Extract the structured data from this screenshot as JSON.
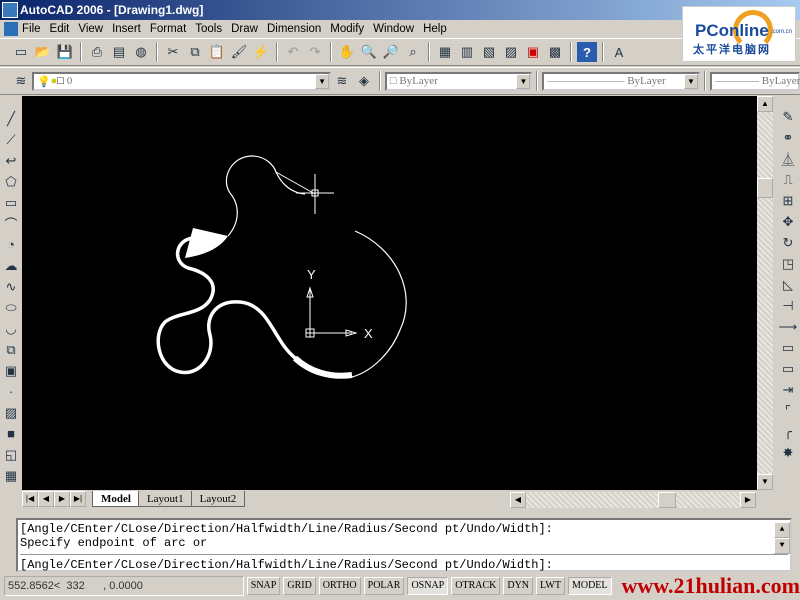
{
  "window": {
    "title": "AutoCAD 2006 - [Drawing1.dwg]"
  },
  "menu": [
    "File",
    "Edit",
    "View",
    "Insert",
    "Format",
    "Tools",
    "Draw",
    "Dimension",
    "Modify",
    "Window",
    "Help"
  ],
  "toolbar_standard": [
    "new-icon",
    "open-icon",
    "save-icon",
    "plot-icon",
    "plot-preview-icon",
    "publish-icon",
    "cut-icon",
    "copy-icon",
    "paste-icon",
    "match-properties-icon",
    "block-editor-icon",
    "undo-icon",
    "redo-icon",
    "pan-icon",
    "zoom-realtime-icon",
    "zoom-window-icon",
    "zoom-previous-icon",
    "properties-icon",
    "design-center-icon",
    "tool-palettes-icon",
    "sheet-set-icon",
    "markup-icon",
    "calculator-icon",
    "help-icon",
    "text-style-icon"
  ],
  "layers": {
    "current_layer": "0"
  },
  "properties": {
    "color": "ByLayer",
    "linetype": "ByLayer",
    "lineweight": "ByLayer"
  },
  "logo": {
    "text": "PConline",
    "subtext": "太平洋电脑网",
    "domain": ".com.cn"
  },
  "ucs": {
    "x_label": "X",
    "y_label": "Y"
  },
  "layout_tabs": [
    {
      "label": "Model",
      "active": true
    },
    {
      "label": "Layout1"
    },
    {
      "label": "Layout2"
    }
  ],
  "command": {
    "history": [
      "[Angle/CEnter/CLose/Direction/Halfwidth/Line/Radius/Second pt/Undo/Width]:",
      "Specify endpoint of arc or"
    ],
    "prompt": "[Angle/CEnter/CLose/Direction/Halfwidth/Line/Radius/Second pt/Undo/Width]:"
  },
  "status": {
    "coordinates": "552.8562<  332      , 0.0000",
    "buttons": [
      {
        "label": "SNAP",
        "on": false
      },
      {
        "label": "GRID",
        "on": false
      },
      {
        "label": "ORTHO",
        "on": false
      },
      {
        "label": "POLAR",
        "on": false
      },
      {
        "label": "OSNAP",
        "on": true
      },
      {
        "label": "OTRACK",
        "on": false
      },
      {
        "label": "DYN",
        "on": false
      },
      {
        "label": "LWT",
        "on": false
      },
      {
        "label": "MODEL",
        "on": true
      }
    ],
    "watermark": "www.21hulian.com"
  },
  "colors": {
    "canvas": "#000000",
    "drawing": "#ffffff",
    "titlebar": "#0a246a",
    "watermark": "#c00000"
  }
}
